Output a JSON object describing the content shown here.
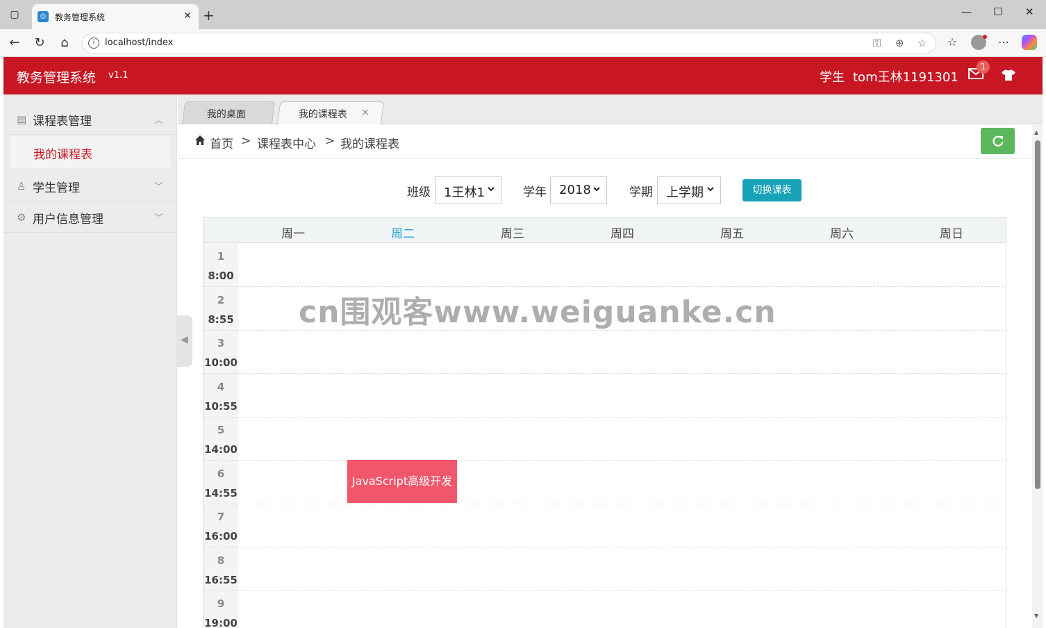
{
  "browser": {
    "tab_title": "教务管理系统",
    "url": "localhost/index"
  },
  "header": {
    "title": "教务管理系统",
    "version": "v1.1",
    "role": "学生",
    "username": "tom王林1191301",
    "mail_count": "1",
    "brand_color": "#c91623"
  },
  "sidebar": {
    "items": [
      {
        "label": "课程表管理",
        "icon": "book-icon",
        "expanded": true
      },
      {
        "label": "我的课程表",
        "icon": "",
        "active": true
      },
      {
        "label": "学生管理",
        "icon": "user-icon",
        "expanded": false
      },
      {
        "label": "用户信息管理",
        "icon": "gear-icon",
        "expanded": false
      }
    ]
  },
  "tabs": [
    {
      "label": "我的桌面"
    },
    {
      "label": "我的课程表",
      "close": "×"
    }
  ],
  "breadcrumb": {
    "home": "首页",
    "sep": ">",
    "level2": "课程表中心",
    "level3": "我的课程表"
  },
  "filters": {
    "class_label": "班级",
    "class_value": "1王林1",
    "year_label": "学年",
    "year_value": "2018",
    "term_label": "学期",
    "term_value": "上学期",
    "switch_button": "切换课表"
  },
  "schedule": {
    "days": [
      "周一",
      "周二",
      "周三",
      "周四",
      "周五",
      "周六",
      "周日"
    ],
    "today_index": 1,
    "periods": [
      {
        "num": "1",
        "time": "8:00"
      },
      {
        "num": "2",
        "time": "8:55"
      },
      {
        "num": "3",
        "time": "10:00"
      },
      {
        "num": "4",
        "time": "10:55"
      },
      {
        "num": "5",
        "time": "14:00"
      },
      {
        "num": "6",
        "time": "14:55"
      },
      {
        "num": "7",
        "time": "16:00"
      },
      {
        "num": "8",
        "time": "16:55"
      },
      {
        "num": "9",
        "time": "19:00"
      }
    ],
    "courses": [
      {
        "name": "JavaScript高级开发",
        "day": "周二",
        "period": "6",
        "color": "#f2566a"
      }
    ]
  },
  "watermark": "cn围观客www.weiguanke.cn"
}
